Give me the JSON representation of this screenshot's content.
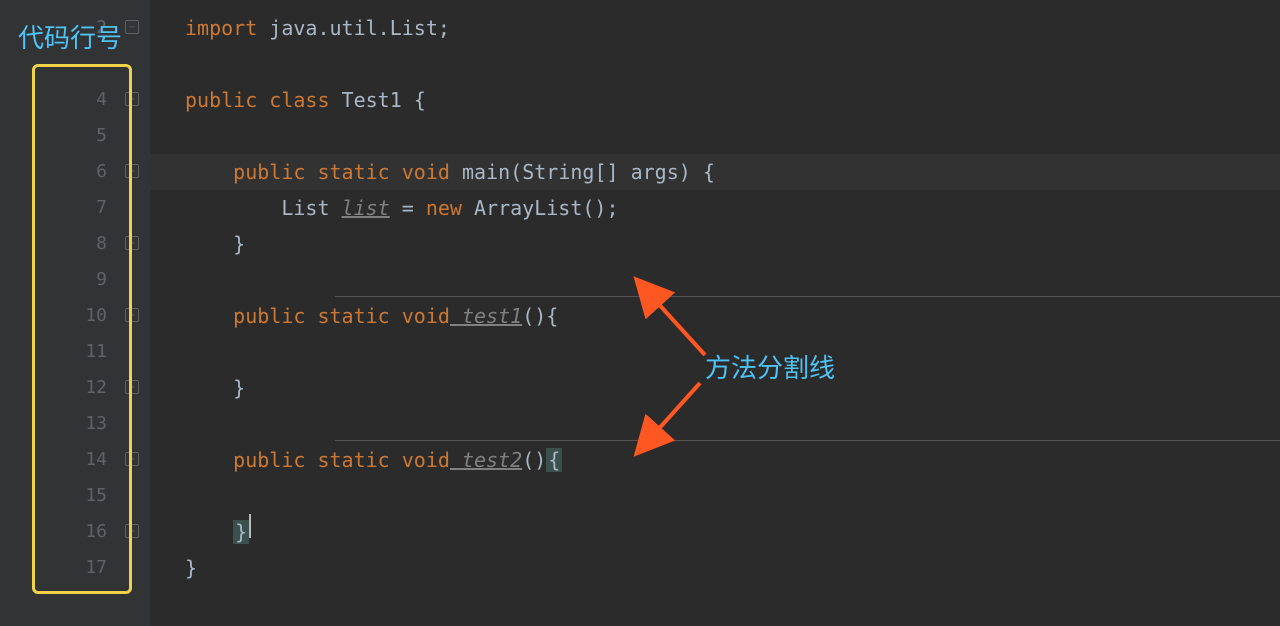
{
  "annotations": {
    "line_number_label": "代码行号",
    "method_separator_label": "方法分割线"
  },
  "lines": {
    "start": 2,
    "values": [
      "2",
      "",
      "4",
      "5",
      "6",
      "7",
      "8",
      "9",
      "10",
      "11",
      "12",
      "13",
      "14",
      "15",
      "16",
      "17"
    ]
  },
  "code": {
    "line1": {
      "import": "import",
      "pkg": " java.util.List;"
    },
    "line4": {
      "public": "public",
      "class": " class",
      "name": " Test1 {"
    },
    "line6": {
      "public": "public",
      "static": " static",
      "void": " void",
      "main": " main",
      "params": "(String[] args) {"
    },
    "line7": {
      "type": "List ",
      "var": "list",
      "eq": " = ",
      "new": "new",
      "ctor": " ArrayList();"
    },
    "line8": {
      "brace": "}"
    },
    "line10": {
      "public": "public",
      "static": " static",
      "void": " void",
      "name": " test1",
      "params": "(){"
    },
    "line12": {
      "brace": "}"
    },
    "line14": {
      "public": "public",
      "static": " static",
      "void": " void",
      "name": " test2",
      "params": "()",
      "brace": "{"
    },
    "line16": {
      "brace": "}"
    },
    "line17": {
      "brace": "}"
    }
  }
}
